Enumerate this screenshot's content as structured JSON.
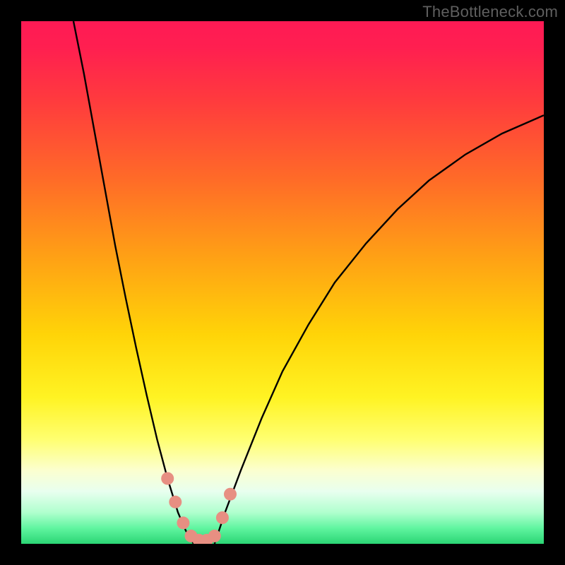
{
  "watermark": "TheBottleneck.com",
  "chart_data": {
    "type": "line",
    "title": "",
    "xlabel": "",
    "ylabel": "",
    "xlim": [
      0,
      100
    ],
    "ylim": [
      0,
      100
    ],
    "background_gradient_stops": [
      {
        "pos": 0.0,
        "color": "#ff1a55"
      },
      {
        "pos": 0.05,
        "color": "#ff1f50"
      },
      {
        "pos": 0.15,
        "color": "#ff3a3e"
      },
      {
        "pos": 0.3,
        "color": "#ff6a28"
      },
      {
        "pos": 0.45,
        "color": "#ffa015"
      },
      {
        "pos": 0.6,
        "color": "#ffd408"
      },
      {
        "pos": 0.72,
        "color": "#fff323"
      },
      {
        "pos": 0.8,
        "color": "#ffff70"
      },
      {
        "pos": 0.86,
        "color": "#fbffd0"
      },
      {
        "pos": 0.9,
        "color": "#e8ffef"
      },
      {
        "pos": 0.94,
        "color": "#b0ffce"
      },
      {
        "pos": 0.97,
        "color": "#60f5a0"
      },
      {
        "pos": 1.0,
        "color": "#2bd574"
      }
    ],
    "series": [
      {
        "name": "left-curve",
        "x": [
          10.0,
          12.0,
          14.0,
          16.0,
          18.0,
          20.0,
          22.0,
          24.0,
          26.0,
          28.0,
          30.0,
          31.5,
          33.0
        ],
        "values": [
          100.0,
          90.0,
          79.0,
          68.0,
          57.0,
          47.0,
          37.5,
          28.5,
          20.0,
          12.5,
          6.0,
          2.5,
          0.0
        ]
      },
      {
        "name": "right-curve",
        "x": [
          37.0,
          39.0,
          42.0,
          46.0,
          50.0,
          55.0,
          60.0,
          66.0,
          72.0,
          78.0,
          85.0,
          92.0,
          100.0
        ],
        "values": [
          0.0,
          6.0,
          14.0,
          24.0,
          33.0,
          42.0,
          50.0,
          57.5,
          64.0,
          69.5,
          74.5,
          78.5,
          82.0
        ]
      }
    ],
    "highlight_dots": {
      "name": "salmon-dots",
      "color": "#e78f82",
      "points": [
        {
          "x": 28.0,
          "y": 12.5
        },
        {
          "x": 29.5,
          "y": 8.0
        },
        {
          "x": 31.0,
          "y": 4.0
        },
        {
          "x": 32.5,
          "y": 1.5
        },
        {
          "x": 34.0,
          "y": 0.7
        },
        {
          "x": 35.5,
          "y": 0.7
        },
        {
          "x": 37.0,
          "y": 1.5
        },
        {
          "x": 38.5,
          "y": 5.0
        },
        {
          "x": 40.0,
          "y": 9.5
        }
      ]
    }
  }
}
